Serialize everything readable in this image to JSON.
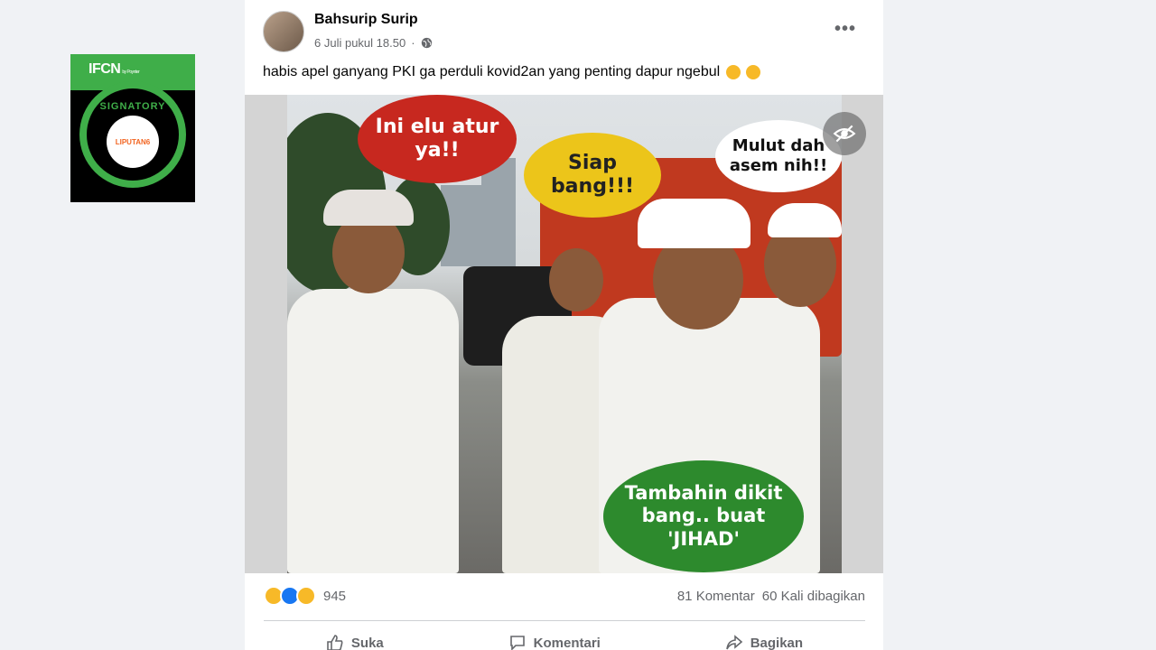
{
  "badge": {
    "logo": "IFCN",
    "ring_text": "SIGNATORY",
    "partner": "LIPUTAN6",
    "logo_small": "by Poynter"
  },
  "post": {
    "author": "Bahsurip Surip",
    "timestamp": "6 Juli pukul 18.50",
    "text": "habis apel ganyang PKI ga perduli kovid2an yang penting dapur ngebul",
    "image": {
      "bubble_red": "Ini elu atur ya!!",
      "bubble_yellow": "Siap bang!!!",
      "bubble_white": "Mulut dah asem nih!!",
      "bubble_green": "Tambahin dikit bang.. buat 'JIHAD'"
    }
  },
  "stats": {
    "reaction_count": "945",
    "comments": "81 Komentar",
    "shares": "60 Kali dibagikan"
  },
  "actions": {
    "like": "Suka",
    "comment": "Komentari",
    "share": "Bagikan"
  },
  "colors": {
    "facebook_blue": "#1877f2",
    "badge_green": "#3fae49",
    "bubble_red": "#c7281f",
    "bubble_yellow": "#ecc51a",
    "bubble_green": "#2d8a2d"
  }
}
